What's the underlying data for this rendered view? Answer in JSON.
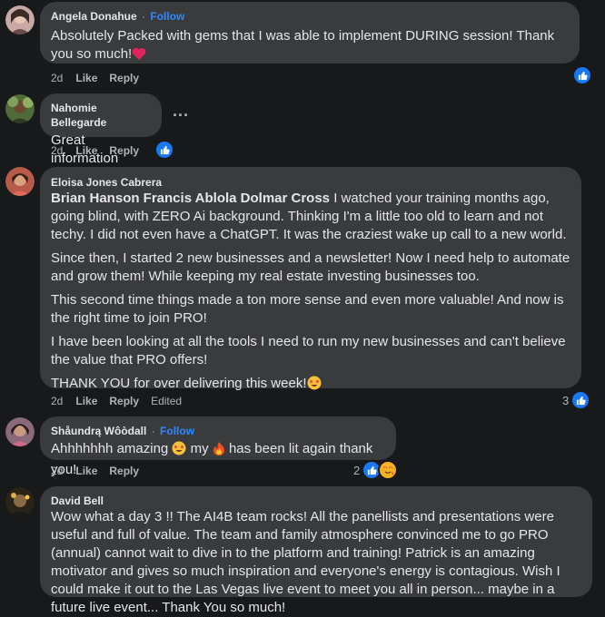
{
  "colors": {
    "background": "#18191a",
    "bubble": "#3a3b3c",
    "text": "#e4e6eb",
    "muted": "#b0b3b8",
    "link": "#2d88ff",
    "like_blue": "#1877f2"
  },
  "comments": [
    {
      "author": "Angela Donahue",
      "separator": "·",
      "follow": "Follow",
      "paragraphs": [
        "Absolutely Packed with gems that I was able to implement DURING session! Thank you so much!"
      ],
      "emoji": "red-heart",
      "time": "2d",
      "like": "Like",
      "reply": "Reply",
      "reactions": {
        "icons": [
          "like-icon"
        ],
        "count": ""
      }
    },
    {
      "author": "Nahomie Bellegarde",
      "paragraphs": [
        "Great information"
      ],
      "more": "...",
      "time": "2d",
      "like": "Like",
      "reply": "Reply",
      "reactions": {
        "icons": [
          "like-icon"
        ],
        "count": ""
      }
    },
    {
      "author": "Eloisa Jones Cabrera",
      "mentions": "Brian Hanson Francis Ablola Dolmar Cross",
      "paragraphs": [
        " I watched your training months ago, going blind, with ZERO Ai background. Thinking I'm a little too old to learn and not techy. I did not even have a ChatGPT. It was the craziest wake up call to a new world.",
        "Since then, I started 2 new businesses and a newsletter! Now I need help to automate and grow them! While keeping my real estate investing businesses too.",
        "This second time things made a ton more sense and even more valuable! And now is the right time to join PRO!",
        "I have been looking at all the tools I need to run my new businesses and can't believe the value that PRO offers!",
        "THANK YOU for over delivering this week!"
      ],
      "emoji": "star-struck",
      "time": "2d",
      "like": "Like",
      "reply": "Reply",
      "edited": "Edited",
      "reactions": {
        "icons": [
          "like-icon"
        ],
        "count": "3"
      }
    },
    {
      "author": "Shåundrą Wôòdall",
      "separator": "·",
      "follow": "Follow",
      "paragraphs": [
        "Ahhhhhhh amazing",
        " my ",
        " has been lit again thank you!"
      ],
      "emoji": [
        "star-struck",
        "fire"
      ],
      "time": "2d",
      "like": "Like",
      "reply": "Reply",
      "reactions": {
        "icons": [
          "like-icon",
          "love-face-icon"
        ],
        "count": "2"
      }
    },
    {
      "author": "David Bell",
      "paragraphs": [
        "Wow what a day 3 !! The AI4B team rocks! All the panellists and presentations were useful and full of value. The team and family atmosphere convinced me to go PRO (annual) cannot wait to dive in to the platform and training! Patrick is an amazing motivator and gives so much inspiration and everyone's energy is contagious. Wish I could make it out to the Las Vegas live event to meet you all in person... maybe in a future live event... Thank You so much!"
      ]
    }
  ]
}
